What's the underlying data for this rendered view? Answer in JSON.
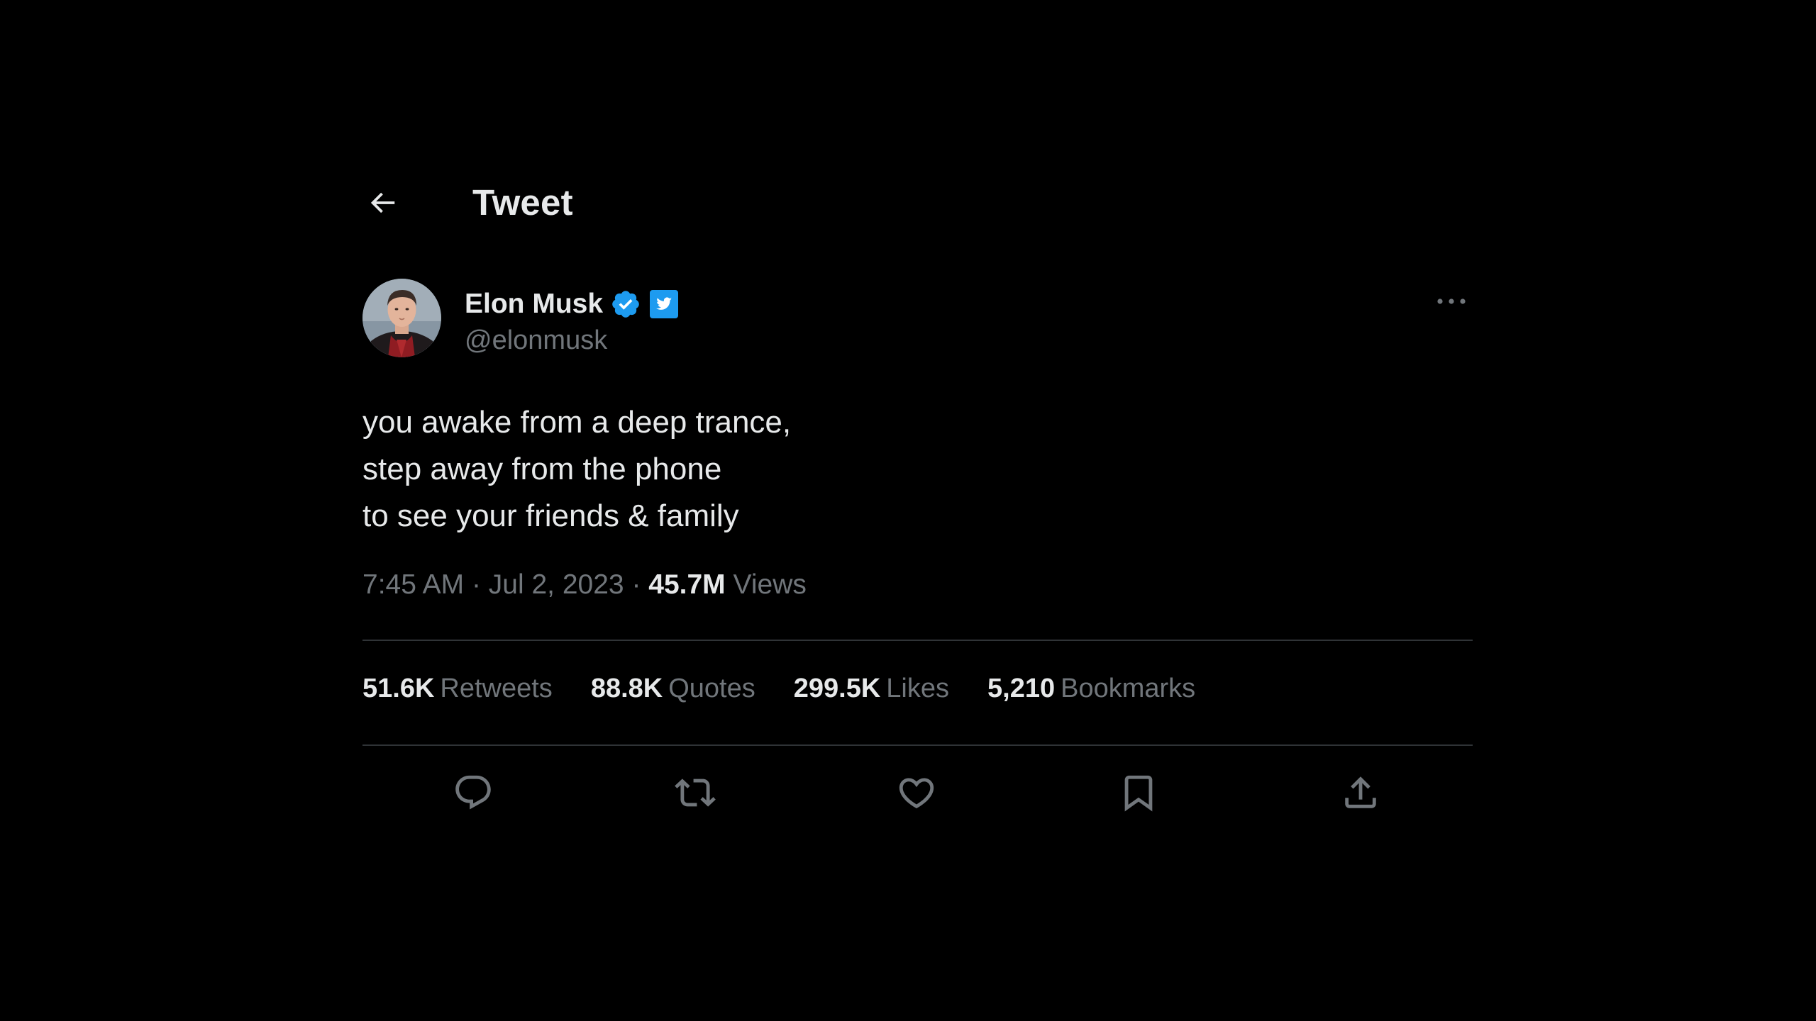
{
  "header": {
    "title": "Tweet"
  },
  "author": {
    "name": "Elon Musk",
    "handle": "@elonmusk",
    "verified": true
  },
  "tweet": {
    "lines": [
      "you awake from a deep trance,",
      "step away from the phone",
      "to see your friends & family"
    ],
    "time": "7:45 AM",
    "separator": "·",
    "date": "Jul 2, 2023",
    "views_count": "45.7M",
    "views_label": "Views"
  },
  "stats": [
    {
      "count": "51.6K",
      "label": "Retweets"
    },
    {
      "count": "88.8K",
      "label": "Quotes"
    },
    {
      "count": "299.5K",
      "label": "Likes"
    },
    {
      "count": "5,210",
      "label": "Bookmarks"
    }
  ],
  "actions": [
    "reply-icon",
    "retweet-icon",
    "like-icon",
    "bookmark-icon",
    "share-icon"
  ],
  "colors": {
    "background": "#000000",
    "text_primary": "#e7e9ea",
    "text_secondary": "#71767b",
    "divider": "#2f3336",
    "verified_blue": "#1d9bf0"
  }
}
